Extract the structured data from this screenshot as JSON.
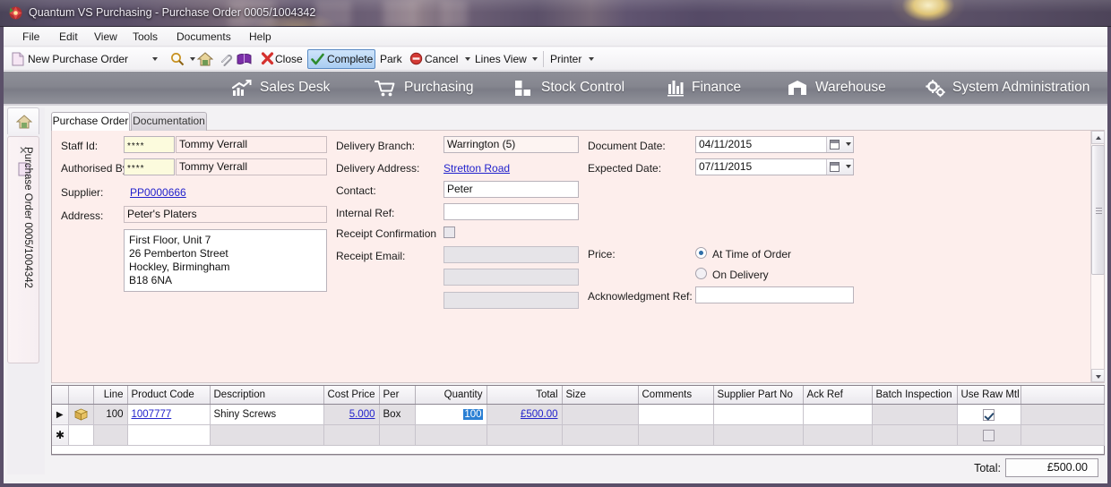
{
  "window": {
    "title": "Quantum VS Purchasing -  Purchase Order 0005/1004342",
    "app_icon": "quantum-app-icon"
  },
  "menubar": {
    "items": [
      {
        "label": "File"
      },
      {
        "label": "Edit"
      },
      {
        "label": "View"
      },
      {
        "label": "Tools"
      },
      {
        "label": "Documents"
      },
      {
        "label": "Help"
      }
    ]
  },
  "toolbar": {
    "new_label": "New Purchase Order",
    "close_label": "Close",
    "complete_label": "Complete",
    "park_label": "Park",
    "cancel_label": "Cancel",
    "lines_view_label": "Lines View",
    "printer_label": "Printer",
    "icons": [
      "new-document-icon",
      "dropdown-caret-icon",
      "search-icon",
      "home-icon",
      "attachment-icon",
      "book-icon",
      "close-x-icon",
      "complete-check-icon",
      "cancel-circle-icon"
    ]
  },
  "navbar": {
    "items": [
      {
        "label": "Sales Desk",
        "icon": "sales-chart-icon"
      },
      {
        "label": "Purchasing",
        "icon": "shopping-cart-icon"
      },
      {
        "label": "Stock Control",
        "icon": "stock-blocks-icon"
      },
      {
        "label": "Finance",
        "icon": "finance-bars-icon"
      },
      {
        "label": "Warehouse",
        "icon": "warehouse-icon"
      },
      {
        "label": "System Administration",
        "icon": "gears-icon"
      }
    ]
  },
  "leftstrip": {
    "home_icon": "home-icon",
    "close_icon": "close-x-icon",
    "doc_icon": "document-icon",
    "doc_label": "Purchase Order 0005/1004342"
  },
  "tabs": [
    {
      "label": "Purchase Order",
      "active": true
    },
    {
      "label": "Documentation",
      "active": false
    }
  ],
  "form": {
    "staff_id": {
      "label": "Staff Id:",
      "code": "****",
      "name": "Tommy Verrall"
    },
    "authorised_by": {
      "label": "Authorised By:",
      "code": "****",
      "name": "Tommy Verrall"
    },
    "supplier": {
      "label": "Supplier:",
      "value": "PP0000666"
    },
    "address": {
      "label": "Address:",
      "name": "Peter's Platers",
      "lines": [
        "First Floor, Unit 7",
        "26 Pemberton Street",
        "Hockley, Birmingham",
        "B18 6NA"
      ]
    },
    "delivery_branch": {
      "label": "Delivery Branch:",
      "value": "Warrington (5)"
    },
    "delivery_address": {
      "label": "Delivery Address:",
      "value": "Stretton Road"
    },
    "contact": {
      "label": "Contact:",
      "value": "Peter"
    },
    "internal_ref": {
      "label": "Internal Ref:",
      "value": ""
    },
    "receipt_confirmation": {
      "label": "Receipt Confirmation",
      "checked": false
    },
    "receipt_email": {
      "label": "Receipt Email:",
      "value1": "",
      "value2": "",
      "value3": ""
    },
    "document_date": {
      "label": "Document Date:",
      "value": "04/11/2015"
    },
    "expected_date": {
      "label": "Expected Date:",
      "value": "07/11/2015"
    },
    "price": {
      "label": "Price:",
      "options": [
        {
          "label": "At Time of Order",
          "selected": true
        },
        {
          "label": "On Delivery",
          "selected": false
        }
      ]
    },
    "acknowledgment_ref": {
      "label": "Acknowledgment Ref:",
      "value": ""
    }
  },
  "lines_grid": {
    "columns": [
      "",
      "",
      "Line",
      "Product Code",
      "Description",
      "Cost Price",
      "Per",
      "Quantity",
      "Total",
      "Size",
      "Comments",
      "Supplier Part No",
      "Ack Ref",
      "Batch Inspection",
      "Use Raw Mtl",
      ""
    ],
    "rows": [
      {
        "selector": "current-row-arrow",
        "icon": "product-box-icon",
        "line": "100",
        "product_code": "1007777",
        "description": "Shiny Screws",
        "cost_price": "5.000",
        "per": "Box",
        "quantity": "100",
        "total": "£500.00",
        "size": "",
        "comments": "",
        "supplier_part_no": "",
        "ack_ref": "",
        "batch_inspection": "",
        "use_raw_mtl": true
      },
      {
        "selector": "new-row-asterisk",
        "icon": "",
        "line": "",
        "product_code": "",
        "description": "",
        "cost_price": "",
        "per": "",
        "quantity": "",
        "total": "",
        "size": "",
        "comments": "",
        "supplier_part_no": "",
        "ack_ref": "",
        "batch_inspection": "",
        "use_raw_mtl": false
      }
    ]
  },
  "footer": {
    "total_label": "Total:",
    "total_value": "£500.00"
  },
  "colors": {
    "accent_blue": "#2a7fd4",
    "form_pink": "#fdeeec",
    "nav_grey": "#85868f",
    "link_blue": "#2222cc",
    "title_purple": "#5b5069"
  }
}
